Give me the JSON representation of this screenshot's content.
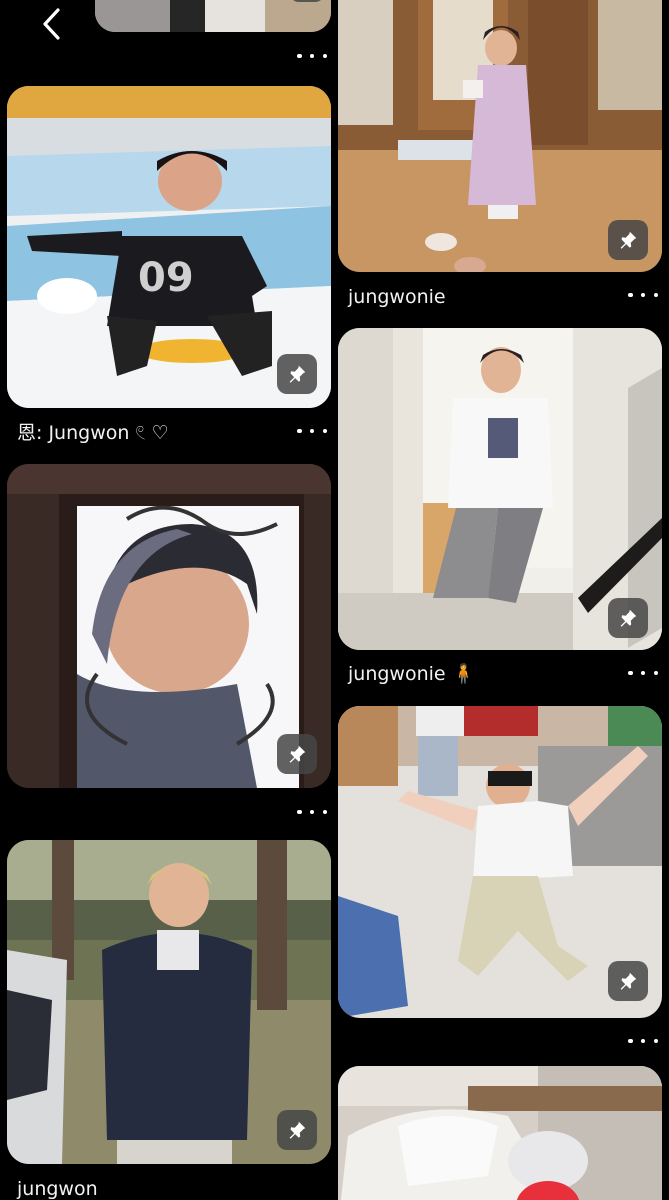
{
  "navigation": {
    "back_icon": "chevron-left-icon"
  },
  "left_column": [
    {
      "caption": ""
    },
    {
      "caption": "恩: Jungwon 𓏲 ♡"
    },
    {
      "caption": ""
    },
    {
      "caption": "jungwon"
    }
  ],
  "right_column": [
    {
      "caption": "jungwonie"
    },
    {
      "caption": "jungwonie 🧍"
    },
    {
      "caption": ""
    },
    {
      "caption": ""
    }
  ],
  "icons": {
    "save": "pushpin-icon",
    "more": "more-options-icon"
  },
  "colors": {
    "background": "#000000",
    "button": "#464646",
    "text": "#f2f2f2"
  }
}
